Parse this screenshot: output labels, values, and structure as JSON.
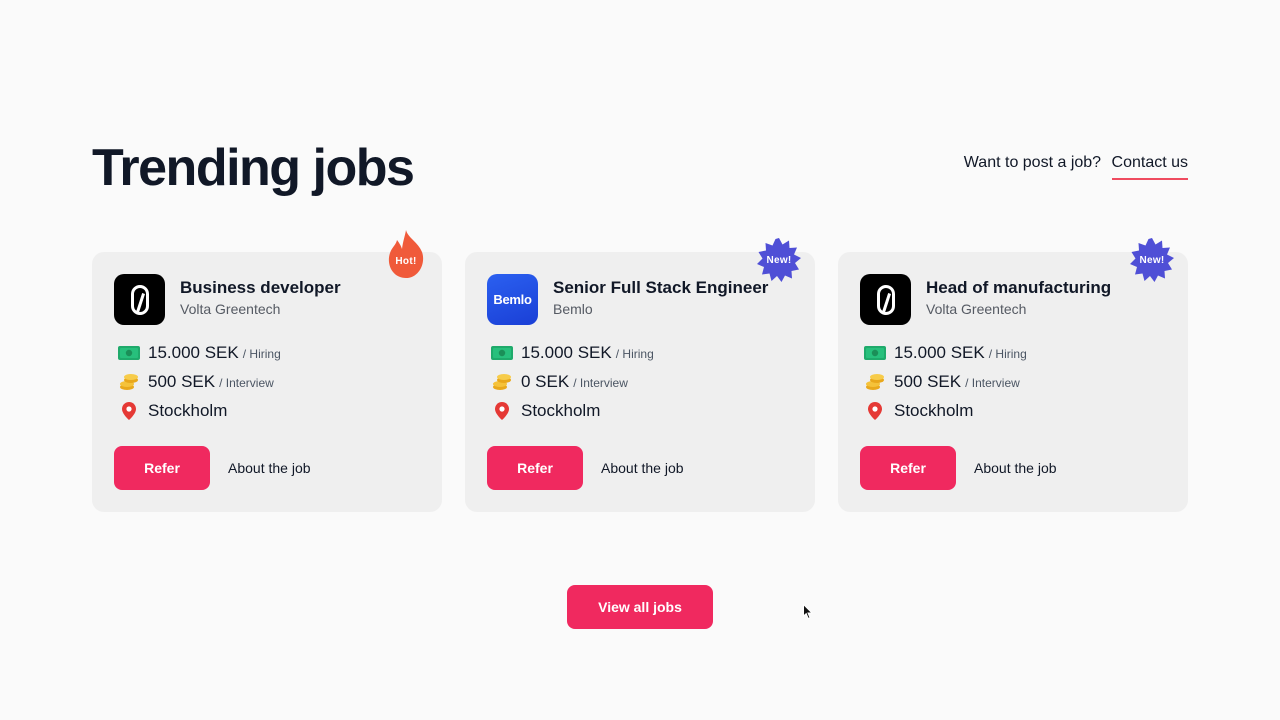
{
  "header": {
    "title": "Trending jobs",
    "post_prompt": "Want to post a job?",
    "contact_link": "Contact us"
  },
  "jobs": [
    {
      "title": "Business developer",
      "company": "Volta Greentech",
      "logo": "volta-logo",
      "badge": "Hot!",
      "hiring_amount": "15.000 SEK",
      "hiring_label": "/ Hiring",
      "interview_amount": "500 SEK",
      "interview_label": "/ Interview",
      "location": "Stockholm",
      "refer_label": "Refer",
      "about_label": "About the job"
    },
    {
      "title": "Senior Full Stack Engineer",
      "company": "Bemlo",
      "logo": "bemlo-logo",
      "logo_text": "Bemlo",
      "badge": "New!",
      "hiring_amount": "15.000 SEK",
      "hiring_label": "/ Hiring",
      "interview_amount": "0 SEK",
      "interview_label": "/ Interview",
      "location": "Stockholm",
      "refer_label": "Refer",
      "about_label": "About the job"
    },
    {
      "title": "Head of manufacturing",
      "company": "Volta Greentech",
      "logo": "volta-logo",
      "badge": "New!",
      "hiring_amount": "15.000 SEK",
      "hiring_label": "/ Hiring",
      "interview_amount": "500 SEK",
      "interview_label": "/ Interview",
      "location": "Stockholm",
      "refer_label": "Refer",
      "about_label": "About the job"
    }
  ],
  "footer": {
    "view_all_label": "View all jobs"
  },
  "icons": {
    "money": "money-bill-icon",
    "coins": "coins-icon",
    "location": "location-pin-icon"
  },
  "colors": {
    "accent": "#f0295f",
    "hot_badge": "#f05a3a",
    "new_badge": "#4f4fd6",
    "card_bg": "#efefef",
    "underline": "#ef4b5f"
  }
}
